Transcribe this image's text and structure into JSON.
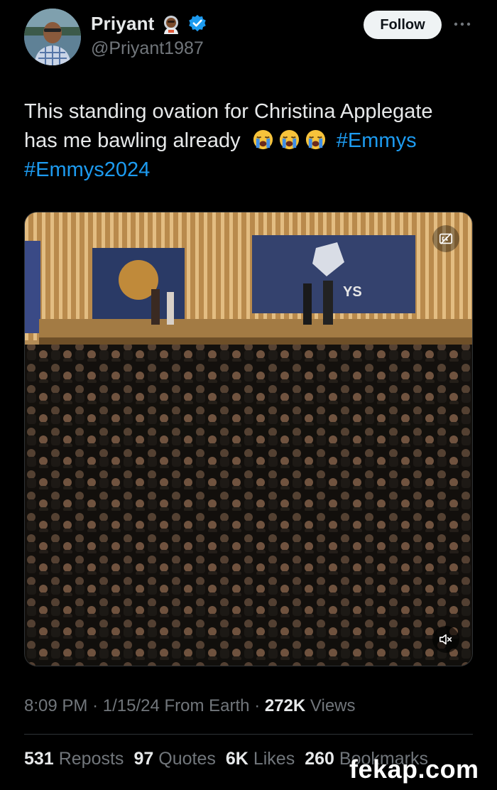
{
  "author": {
    "display_name": "Priyant",
    "handle": "@Priyant1987",
    "name_emoji": "astronaut-emoji",
    "verified_icon": "verified-badge-icon",
    "verified_color": "#1d9bf0"
  },
  "header": {
    "follow_label": "Follow",
    "more_icon": "more-icon"
  },
  "tweet": {
    "text_line1": "This standing ovation for Christina Applegate",
    "text_line2": "has me bawling already",
    "emoji": [
      "loudly-crying-face",
      "loudly-crying-face",
      "loudly-crying-face"
    ],
    "hashtag1": "#Emmys",
    "hashtag2": "#Emmys2024",
    "hashtag_color": "#1d9bf0"
  },
  "media": {
    "type": "video",
    "screen_text": "YS",
    "captions_icon": "captions-off-icon",
    "mute_icon": "muted-speaker-icon"
  },
  "meta": {
    "time": "8:09 PM",
    "date": "1/15/24",
    "location": "From Earth",
    "views_count": "272K",
    "views_label": "Views"
  },
  "stats": {
    "reposts_count": "531",
    "reposts_label": "Reposts",
    "quotes_count": "97",
    "quotes_label": "Quotes",
    "likes_count": "6K",
    "likes_label": "Likes",
    "bookmarks_count": "260",
    "bookmarks_label": "Bookmarks"
  },
  "watermark": "fekap.com"
}
